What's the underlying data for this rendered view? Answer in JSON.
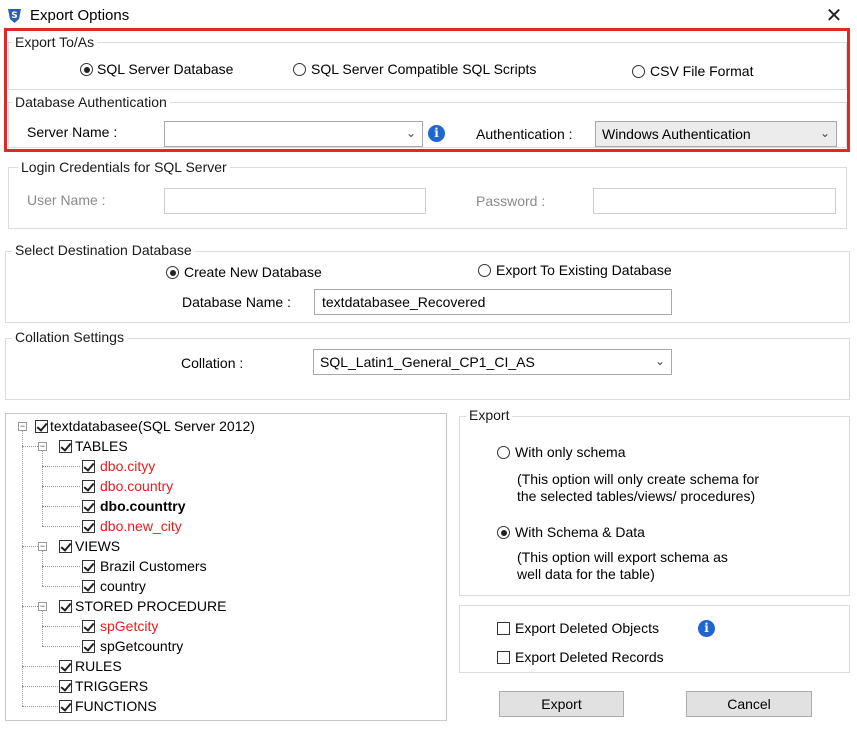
{
  "window": {
    "title": "Export Options",
    "close_glyph": "✕"
  },
  "export_to": {
    "legend": "Export To/As",
    "options": [
      {
        "label": "SQL Server Database",
        "checked": true
      },
      {
        "label": "SQL Server Compatible SQL Scripts",
        "checked": false
      },
      {
        "label": "CSV File Format",
        "checked": false
      }
    ]
  },
  "db_auth": {
    "legend": "Database Authentication",
    "server_label": "Server Name :",
    "server_value": "",
    "auth_label": "Authentication :",
    "auth_value": "Windows Authentication"
  },
  "login": {
    "legend": "Login Credentials for SQL Server",
    "user_label": "User Name :",
    "user_value": "",
    "password_label": "Password :",
    "password_value": ""
  },
  "destination": {
    "legend": "Select Destination Database",
    "create_label": "Create New Database",
    "create_checked": true,
    "existing_label": "Export To Existing Database",
    "existing_checked": false,
    "db_name_label": "Database Name :",
    "db_name_value": "textdatabasee_Recovered"
  },
  "collation": {
    "legend": "Collation Settings",
    "label": "Collation :",
    "value": "SQL_Latin1_General_CP1_CI_AS"
  },
  "tree": {
    "root": "textdatabasee(SQL Server 2012)",
    "tables": "TABLES",
    "table_items": [
      "dbo.cityy",
      "dbo.country",
      "dbo.counttry",
      "dbo.new_city"
    ],
    "views": "VIEWS",
    "view_items": [
      "Brazil Customers",
      "country"
    ],
    "procs": "STORED PROCEDURE",
    "proc_items": [
      "spGetcity",
      "spGetcountry"
    ],
    "rules": "RULES",
    "triggers": "TRIGGERS",
    "functions": "FUNCTIONS",
    "colors": {
      "deleted": "#e02020"
    }
  },
  "export": {
    "legend": "Export",
    "schema_only_label": "With only schema",
    "schema_only_desc_1": "(This option will only create schema for",
    "schema_only_desc_2": "the  selected tables/views/ procedures)",
    "schema_data_label": "With Schema & Data",
    "schema_data_desc_1": "(This option will export schema as",
    "schema_data_desc_2": "well data for the table)",
    "schema_data_checked": true
  },
  "deleted": {
    "objects_label": "Export Deleted Objects",
    "records_label": "Export Deleted Records"
  },
  "buttons": {
    "export": "Export",
    "cancel": "Cancel"
  },
  "colors": {
    "highlight_border": "#e02828",
    "info_blue": "#1f66d0"
  }
}
